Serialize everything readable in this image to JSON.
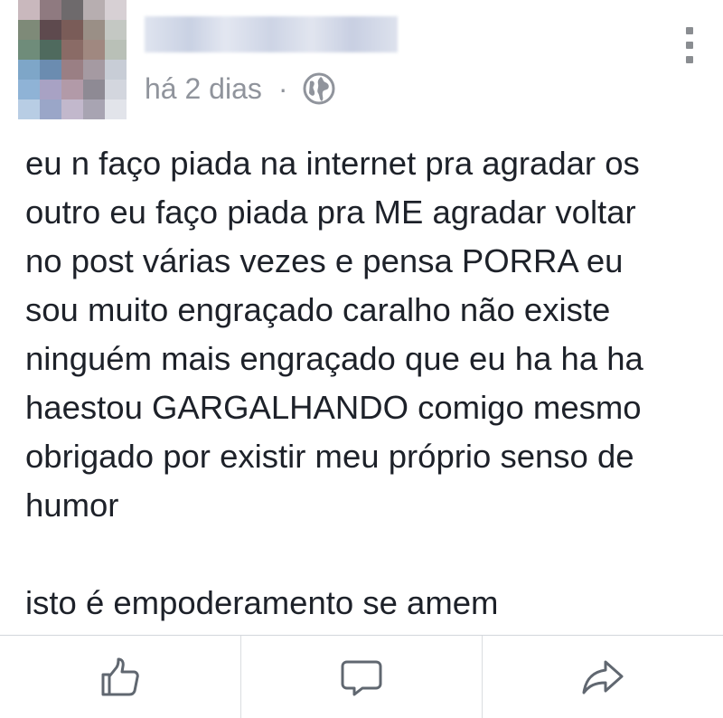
{
  "post": {
    "author_name": "",
    "timestamp": "há 2 dias",
    "separator": "·",
    "audience_icon": "globe-icon",
    "menu_icon": "more-options-icon",
    "text": "eu n faço piada na internet pra agradar os\noutro eu faço piada pra ME agradar voltar\nno post várias vezes e pensa PORRA eu\nsou muito engraçado caralho não existe\nninguém mais engraçado que eu ha ha ha\nhaestou GARGALHANDO comigo mesmo\nobrigado por existir meu próprio senso de\nhumor\n\nisto é empoderamento se amem"
  },
  "actions": [
    {
      "icon": "like-icon"
    },
    {
      "icon": "comment-icon"
    },
    {
      "icon": "share-icon"
    }
  ],
  "colors": {
    "text": "#1d2129",
    "meta": "#90949c",
    "icon": "#606770",
    "divider": "#d3d6db"
  }
}
